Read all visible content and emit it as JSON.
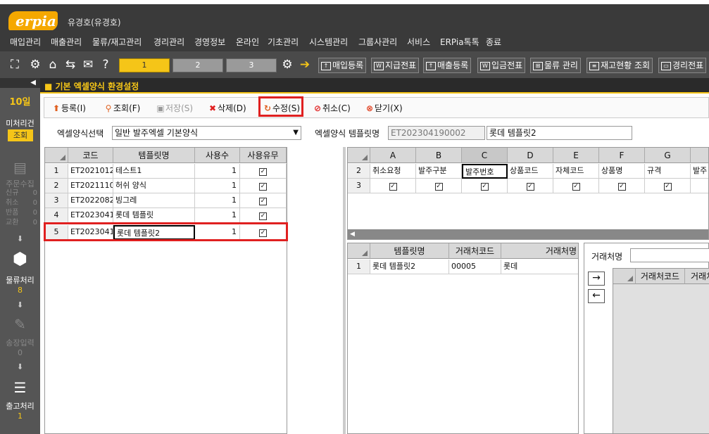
{
  "app": {
    "logo_text": "erpia",
    "user": "유경호(유경호)"
  },
  "menu": [
    "매입관리",
    "매출관리",
    "물류/재고관리",
    "경리관리",
    "경영정보",
    "온라인",
    "기초관리",
    "시스템관리",
    "그룹사관리",
    "서비스",
    "ERPia톡톡",
    "종료"
  ],
  "toolbar": {
    "tabs": [
      "1",
      "2",
      "3"
    ],
    "quick": [
      {
        "label": "매입등록",
        "icon": "upload-icon"
      },
      {
        "label": "지급전표",
        "icon": "document-w-icon"
      },
      {
        "label": "매출등록",
        "icon": "upload-icon"
      },
      {
        "label": "입금전표",
        "icon": "document-w-icon"
      },
      {
        "label": "물류 관리",
        "icon": "cart-icon"
      },
      {
        "label": "재고현황 조회",
        "icon": "table-icon"
      },
      {
        "label": "경리전표",
        "icon": "document-icon"
      }
    ]
  },
  "sidebar": {
    "date_day": "10일",
    "unprocessed_label": "미처리건",
    "lookup_btn": "조회",
    "order_collect": "주문수집",
    "stats": [
      {
        "k": "신규",
        "v": "0"
      },
      {
        "k": "취소",
        "v": "0"
      },
      {
        "k": "반품",
        "v": "0"
      },
      {
        "k": "교환",
        "v": "0"
      }
    ],
    "logistics_label": "물류처리",
    "logistics_count": "8",
    "invoice_label": "송장입력",
    "invoice_count": "0",
    "shipping_label": "출고처리",
    "shipping_count": "1"
  },
  "panel": {
    "title": "■ 기본 엑셀양식 환경설정"
  },
  "actions": {
    "register": "등록(I)",
    "lookup": "조회(F)",
    "save": "저장(S)",
    "delete": "삭제(D)",
    "edit": "수정(S)",
    "cancel": "취소(C)",
    "close": "닫기(X)"
  },
  "form": {
    "excel_form_select_label": "엑셀양식선택",
    "excel_form_select_value": "일반 발주엑셀 기본양식",
    "template_name_label": "엑셀양식 템플릿명",
    "template_code_value": "ET202304190002",
    "template_name_value": "롯데 템플릿2"
  },
  "left_grid": {
    "headers": [
      "코드",
      "템플릿명",
      "사용수",
      "사용유무"
    ],
    "rows": [
      {
        "n": "1",
        "code": "ET20210120(",
        "name": "테스트1",
        "count": "1",
        "use": true
      },
      {
        "n": "2",
        "code": "ET20211102(",
        "name": "허쉬 양식",
        "count": "1",
        "use": true
      },
      {
        "n": "3",
        "code": "ET20220824(",
        "name": "빙그레",
        "count": "1",
        "use": true
      },
      {
        "n": "4",
        "code": "ET20230419(",
        "name": "롯데 템플릿",
        "count": "1",
        "use": true
      },
      {
        "n": "5",
        "code": "ET20230419",
        "name": "롯데 템플릿2",
        "count": "1",
        "use": true
      }
    ]
  },
  "right_grid": {
    "col_letters": [
      "A",
      "B",
      "C",
      "D",
      "E",
      "F",
      "G",
      ""
    ],
    "row2_num": "2",
    "row2": [
      "취소요청",
      "발주구분",
      "발주번호",
      "상품코드",
      "자체코드",
      "상품명",
      "규격",
      "발주"
    ],
    "row3_num": "3",
    "row3_checked": [
      true,
      true,
      true,
      true,
      true,
      true,
      true
    ]
  },
  "template_grid": {
    "headers": [
      "템플릿명",
      "거래처코드",
      "거래처명"
    ],
    "rows": [
      {
        "n": "1",
        "name": "롯데 템플릿2",
        "code": "00005",
        "client": "롯데"
      }
    ]
  },
  "client_panel": {
    "label": "거래처명",
    "headers": [
      "거래처코드",
      "거래처"
    ],
    "add_arrow": "→",
    "remove_arrow": "←"
  }
}
